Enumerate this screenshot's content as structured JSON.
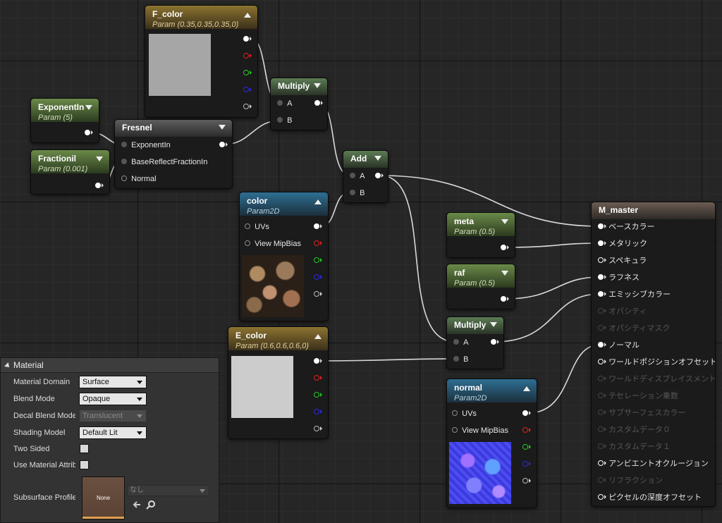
{
  "nodes": {
    "f_color": {
      "title": "F_color",
      "subtitle": "Param (0.35,0.35,0.35,0)"
    },
    "exponent_in": {
      "title": "ExponentIn",
      "subtitle": "Param (5)"
    },
    "fraction_il": {
      "title": "Fractionil",
      "subtitle": "Param (0.001)"
    },
    "fresnel": {
      "title": "Fresnel",
      "inputs": [
        "ExponentIn",
        "BaseReflectFractionIn",
        "Normal"
      ]
    },
    "multiply1": {
      "title": "Multiply",
      "inputs": [
        "A",
        "B"
      ]
    },
    "add": {
      "title": "Add",
      "inputs": [
        "A",
        "B"
      ]
    },
    "color": {
      "title": "color",
      "subtitle": "Param2D",
      "inputs": [
        "UVs",
        "View MipBias"
      ]
    },
    "e_color": {
      "title": "E_color",
      "subtitle": "Param (0.6,0.6,0.6,0)"
    },
    "meta": {
      "title": "meta",
      "subtitle": "Param (0.5)"
    },
    "raf": {
      "title": "raf",
      "subtitle": "Param (0.5)"
    },
    "multiply2": {
      "title": "Multiply",
      "inputs": [
        "A",
        "B"
      ]
    },
    "normal": {
      "title": "normal",
      "subtitle": "Param2D",
      "inputs": [
        "UVs",
        "View MipBias"
      ]
    },
    "m_master": {
      "title": "M_master",
      "inputs": [
        "ベースカラー",
        "メタリック",
        "スペキュラ",
        "ラフネス",
        "エミッシブカラー",
        "オパシティ",
        "オパシティマスク",
        "ノーマル",
        "ワールドポジションオフセット",
        "ワールドディスプレイスメント",
        "テセレーション乗数",
        "サブサーフェスカラー",
        "カスタムデータ０",
        "カスタムデータ１",
        "アンビエントオクルージョン",
        "リフラクション",
        "ピクセルの深度オフセット"
      ]
    }
  },
  "details": {
    "header": "Material",
    "rows": {
      "material_domain": {
        "label": "Material Domain",
        "value": "Surface"
      },
      "blend_mode": {
        "label": "Blend Mode",
        "value": "Opaque"
      },
      "decal_blend_mode": {
        "label": "Decal Blend Mode",
        "value": "Translucent"
      },
      "shading_model": {
        "label": "Shading Model",
        "value": "Default Lit"
      },
      "two_sided": {
        "label": "Two Sided"
      },
      "use_material_attributes": {
        "label": "Use Material Attribu"
      },
      "subsurface_profile": {
        "label": "Subsurface Profile",
        "thumb": "None",
        "combo": "なし"
      }
    }
  },
  "colors": {
    "wire": "#d9d9d9",
    "f_color_swatch": "#a6a6a6",
    "e_color_swatch": "#cccccc"
  }
}
